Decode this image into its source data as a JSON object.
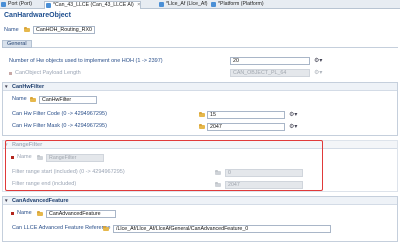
{
  "tabs": [
    {
      "label": "Port (Port)",
      "color": "#4a8fd6"
    },
    {
      "label": "*Can_43_LLCE (Can_43_LLCE Al)",
      "color": "#4a8fd6"
    },
    {
      "label": "*Llce_Af (Llce_Af)",
      "color": "#4a8fd6"
    },
    {
      "label": "*Platform (Platform)",
      "color": "#4a8fd6"
    }
  ],
  "editor": {
    "title": "CanHardwareObject",
    "name_label": "Name",
    "name_value": "CanHOH_Routing_RX0",
    "general_tab": "General"
  },
  "general": {
    "hoh_count_label": "Number of Hw objects used to implement one HOH (1 -> 2397)",
    "hoh_count_value": "20",
    "payload_label": "CanObject Payload Length",
    "payload_value": "CAN_OBJECT_PL_64"
  },
  "hw_filter": {
    "header": "CanHwFilter",
    "name_label": "Name",
    "name_value": "CanHwFilter",
    "code_label": "Can Hw Filter Code (0 -> 4294967295)",
    "code_value": "15",
    "mask_label": "Can Hw Filter Mask (0 -> 4294967295)",
    "mask_value": "2047"
  },
  "range_filter": {
    "header": "RangeFilter",
    "name_label": "Name",
    "name_value": "RangeFilter",
    "start_label": "Filter range start (included) (0 -> 4294967295)",
    "start_value": "0",
    "end_label": "Filter range end (included)",
    "end_value": "2047"
  },
  "advanced": {
    "header": "CanAdvancedFeature",
    "name_label": "Name",
    "name_value": "CanAdvancedFeature",
    "ref_label": "Can LLCE Advanced Feature Reference",
    "ref_value": "/Llce_Af/Llce_Af/LlceAfGeneral/CanAdvancedFeature_0"
  },
  "icons": {
    "action": "▾",
    "twisty": "▾",
    "chevron": "⌄"
  }
}
